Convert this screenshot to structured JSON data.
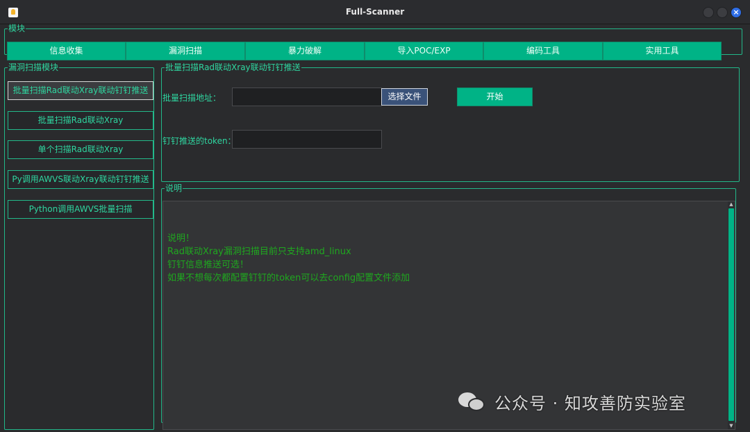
{
  "window": {
    "title": "Full-Scanner"
  },
  "modules": {
    "legend": "模块",
    "buttons": [
      "信息收集",
      "漏洞扫描",
      "暴力破解",
      "导入POC/EXP",
      "编码工具",
      "实用工具"
    ]
  },
  "sidebar": {
    "legend": "漏洞扫描模块",
    "items": [
      "批量扫描Rad联动Xray联动钉钉推送",
      "批量扫描Rad联动Xray",
      "单个扫描Rad联动Xray",
      "Py调用AWVS联动Xray联动钉钉推送",
      "Python调用AWVS批量扫描"
    ],
    "active_index": 0
  },
  "form": {
    "legend": "批量扫描Rad联动Xray联动钉钉推送",
    "address_label": "批量扫描地址：",
    "address_value": "",
    "choose_file": "选择文件",
    "start": "开始",
    "token_label": "钉钉推送的token：",
    "token_value": ""
  },
  "description": {
    "legend": "说明",
    "lines": [
      "说明！",
      "Rad联动Xray漏洞扫描目前只支持amd_linux",
      "钉钉信息推送可选！",
      "如果不想每次都配置钉钉的token可以去config配置文件添加"
    ]
  },
  "watermark": {
    "text": "公众号 · 知攻善防实验室"
  },
  "colors": {
    "accent": "#00b386",
    "text": "#2fd6a0",
    "desc_text": "#1fa81f",
    "window_bg": "#2a2b2d"
  }
}
